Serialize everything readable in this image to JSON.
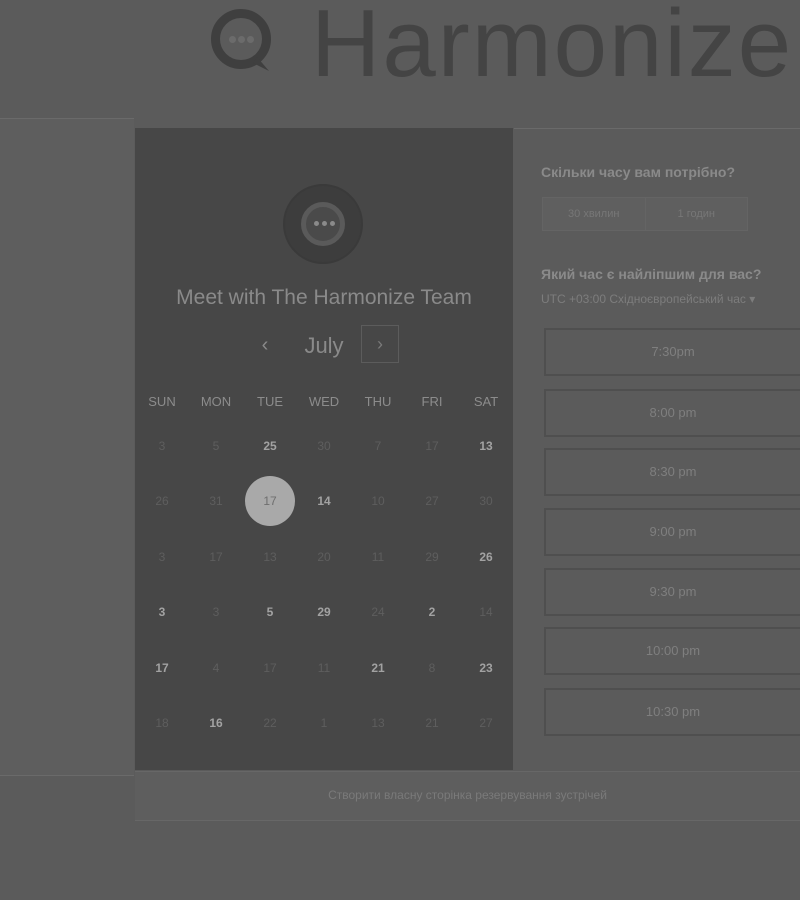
{
  "brand": {
    "name": "Harmonize",
    "logo_icon": "harmonize-chat-logo-icon"
  },
  "calendar": {
    "title": "Meet with The Harmonize Team",
    "month": "July",
    "prev_icon": "‹",
    "next_icon": "›",
    "weekdays": [
      "SUN",
      "MON",
      "TUE",
      "WED",
      "THU",
      "FRI",
      "SAT"
    ],
    "weeks": [
      [
        {
          "d": "3"
        },
        {
          "d": "5"
        },
        {
          "d": "25",
          "b": true
        },
        {
          "d": "30"
        },
        {
          "d": "7"
        },
        {
          "d": "17"
        },
        {
          "d": "13",
          "b": true
        }
      ],
      [
        {
          "d": "26"
        },
        {
          "d": "31"
        },
        {
          "d": "17",
          "sel": true
        },
        {
          "d": "14",
          "b": true
        },
        {
          "d": "10"
        },
        {
          "d": "27"
        },
        {
          "d": "30"
        }
      ],
      [
        {
          "d": "3"
        },
        {
          "d": "17"
        },
        {
          "d": "13"
        },
        {
          "d": "20"
        },
        {
          "d": "11"
        },
        {
          "d": "29"
        },
        {
          "d": "26",
          "b": true
        }
      ],
      [
        {
          "d": "3",
          "b": true
        },
        {
          "d": "3"
        },
        {
          "d": "5",
          "b": true
        },
        {
          "d": "29",
          "b": true
        },
        {
          "d": "24"
        },
        {
          "d": "2",
          "b": true
        },
        {
          "d": "14"
        }
      ],
      [
        {
          "d": "17",
          "b": true
        },
        {
          "d": "4"
        },
        {
          "d": "17"
        },
        {
          "d": "11"
        },
        {
          "d": "21",
          "b": true
        },
        {
          "d": "8"
        },
        {
          "d": "23",
          "b": true
        }
      ],
      [
        {
          "d": "18"
        },
        {
          "d": "16",
          "b": true
        },
        {
          "d": "22"
        },
        {
          "d": "1"
        },
        {
          "d": "13"
        },
        {
          "d": "21"
        },
        {
          "d": "27"
        }
      ]
    ]
  },
  "booking": {
    "duration_question": "Скільки часу вам потрібно?",
    "durations": [
      "30 хвилин",
      "1 годин"
    ],
    "time_question": "Який час є найліпшим для вас?",
    "timezone": "UTC +03:00 Східноєвропейський час ▾",
    "slots": [
      "7:30pm",
      "8:00 pm",
      "8:30 pm",
      "9:00 pm",
      "9:30 pm",
      "10:00 pm",
      "10:30 pm"
    ]
  },
  "footer": {
    "link": "Створити власну сторінка резервування зустрічей"
  }
}
